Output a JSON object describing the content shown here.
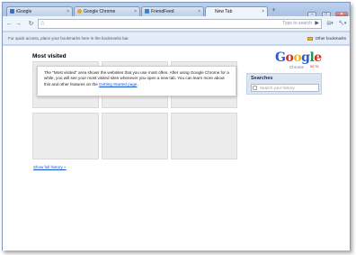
{
  "window": {
    "tabs": [
      {
        "label": "iGoogle",
        "icon": "google-favicon",
        "active": false,
        "color": "#3f6fc2"
      },
      {
        "label": "Google Chrome",
        "icon": "chrome-favicon",
        "active": false,
        "color": "#e6a62a"
      },
      {
        "label": "FriendFeed",
        "icon": "friendfeed-favicon",
        "active": false,
        "color": "#3d7fd1"
      },
      {
        "label": "New Tab",
        "icon": "",
        "active": true,
        "color": ""
      }
    ],
    "new_tab_glyph": "+",
    "window_buttons": {
      "minimize": "–",
      "maximize": "□",
      "close": "✕"
    }
  },
  "toolbar": {
    "back": "←",
    "forward": "→",
    "reload": "↻",
    "home": "☆",
    "omnibox_placeholder": "Type to search",
    "go": "▶",
    "page_menu": "▤▾",
    "tools_menu": "🔧▾"
  },
  "bookmarks_bar": {
    "hint": "For quick access, place your bookmarks here in the bookmarks bar.",
    "other_bookmarks": "Other bookmarks"
  },
  "content": {
    "most_visited_title": "Most visited",
    "notice_text": "The \"Most visited\" area shows the websites that you use most often. After using Google Chrome for a while, you will see your most visited sites whenever you open a new tab. You can learn more about this and other features on the ",
    "notice_link": "Getting Started page",
    "notice_end": ".",
    "show_full_history": "Show full history »",
    "logo": {
      "word": "Google",
      "sub": "Chrome",
      "beta": "BETA"
    },
    "searches_title": "Searches",
    "search_placeholder": "Search your history"
  }
}
